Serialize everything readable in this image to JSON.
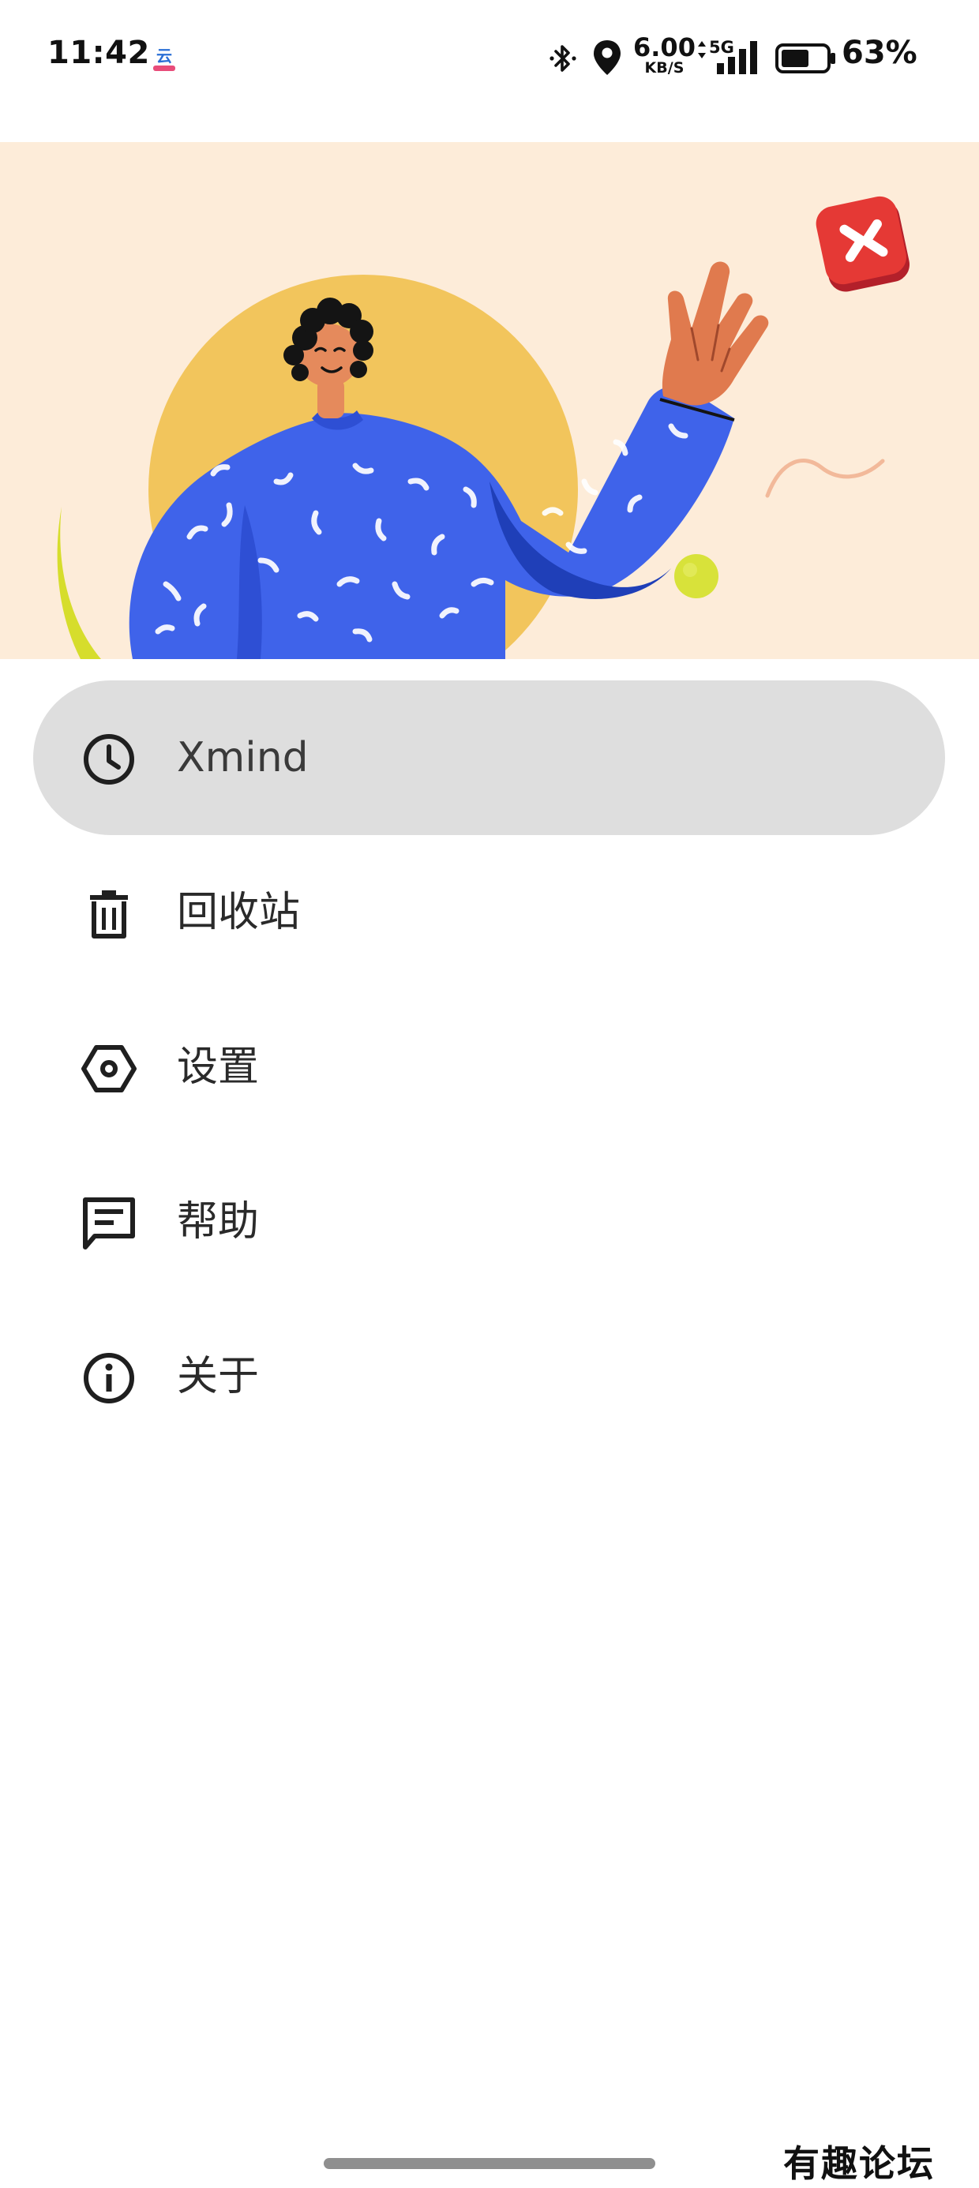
{
  "status_bar": {
    "time": "11:42",
    "app_icon": "cloud-app-icon",
    "bluetooth_icon": "bluetooth-icon",
    "location_icon": "location-pin-icon",
    "network_speed_value": "6.00",
    "network_speed_unit": "KB/S",
    "network_type": "5G",
    "signal_icon": "signal-bars-icon",
    "battery_level": 0.63,
    "battery_percent": "63%"
  },
  "header": {
    "illustration": "person-waving-illustration",
    "logo_icon": "xmind-logo-icon",
    "colors": {
      "background": "#fdecd9",
      "sun": "#f2c55c",
      "shirt": "#3f63ea",
      "ball": "#d8e23a",
      "logo": "#e53935"
    }
  },
  "drawer": {
    "items": [
      {
        "label": "Xmind",
        "icon": "clock-icon",
        "active": true
      },
      {
        "label": "回收站",
        "icon": "trash-icon",
        "active": false
      },
      {
        "label": "设置",
        "icon": "hexagon-settings-icon",
        "active": false
      },
      {
        "label": "帮助",
        "icon": "feedback-message-icon",
        "active": false
      },
      {
        "label": "关于",
        "icon": "info-icon",
        "active": false
      }
    ],
    "active_background": "#dedede"
  },
  "watermark": "有趣论坛"
}
